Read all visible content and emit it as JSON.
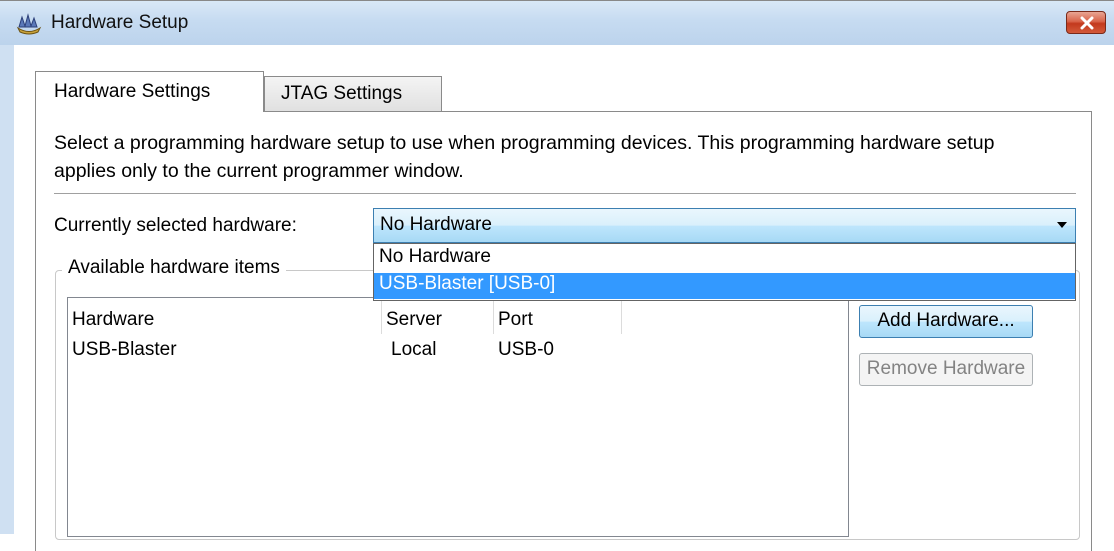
{
  "window": {
    "title": "Hardware Setup",
    "icon": "hardware-setup-app-icon",
    "close_icon": "close-icon"
  },
  "tabs": [
    {
      "label": "Hardware Settings",
      "active": true
    },
    {
      "label": "JTAG Settings",
      "active": false
    }
  ],
  "description": "Select a programming hardware setup to use when programming devices. This programming hardware setup applies only to the current programmer window.",
  "selected_hardware": {
    "label": "Currently selected hardware:",
    "value": "No Hardware",
    "options": [
      "No Hardware",
      "USB-Blaster [USB-0]"
    ],
    "highlighted_option": "USB-Blaster [USB-0]"
  },
  "available": {
    "group_label": "Available hardware items",
    "columns": [
      "Hardware",
      "Server",
      "Port"
    ],
    "rows": [
      {
        "hardware": "USB-Blaster",
        "server": "Local",
        "port": "USB-0"
      }
    ]
  },
  "buttons": {
    "add": "Add Hardware...",
    "remove": "Remove Hardware"
  },
  "colors": {
    "selection": "#3399ff",
    "titlebar": "#c6dbf1",
    "close": "#c3391d"
  }
}
